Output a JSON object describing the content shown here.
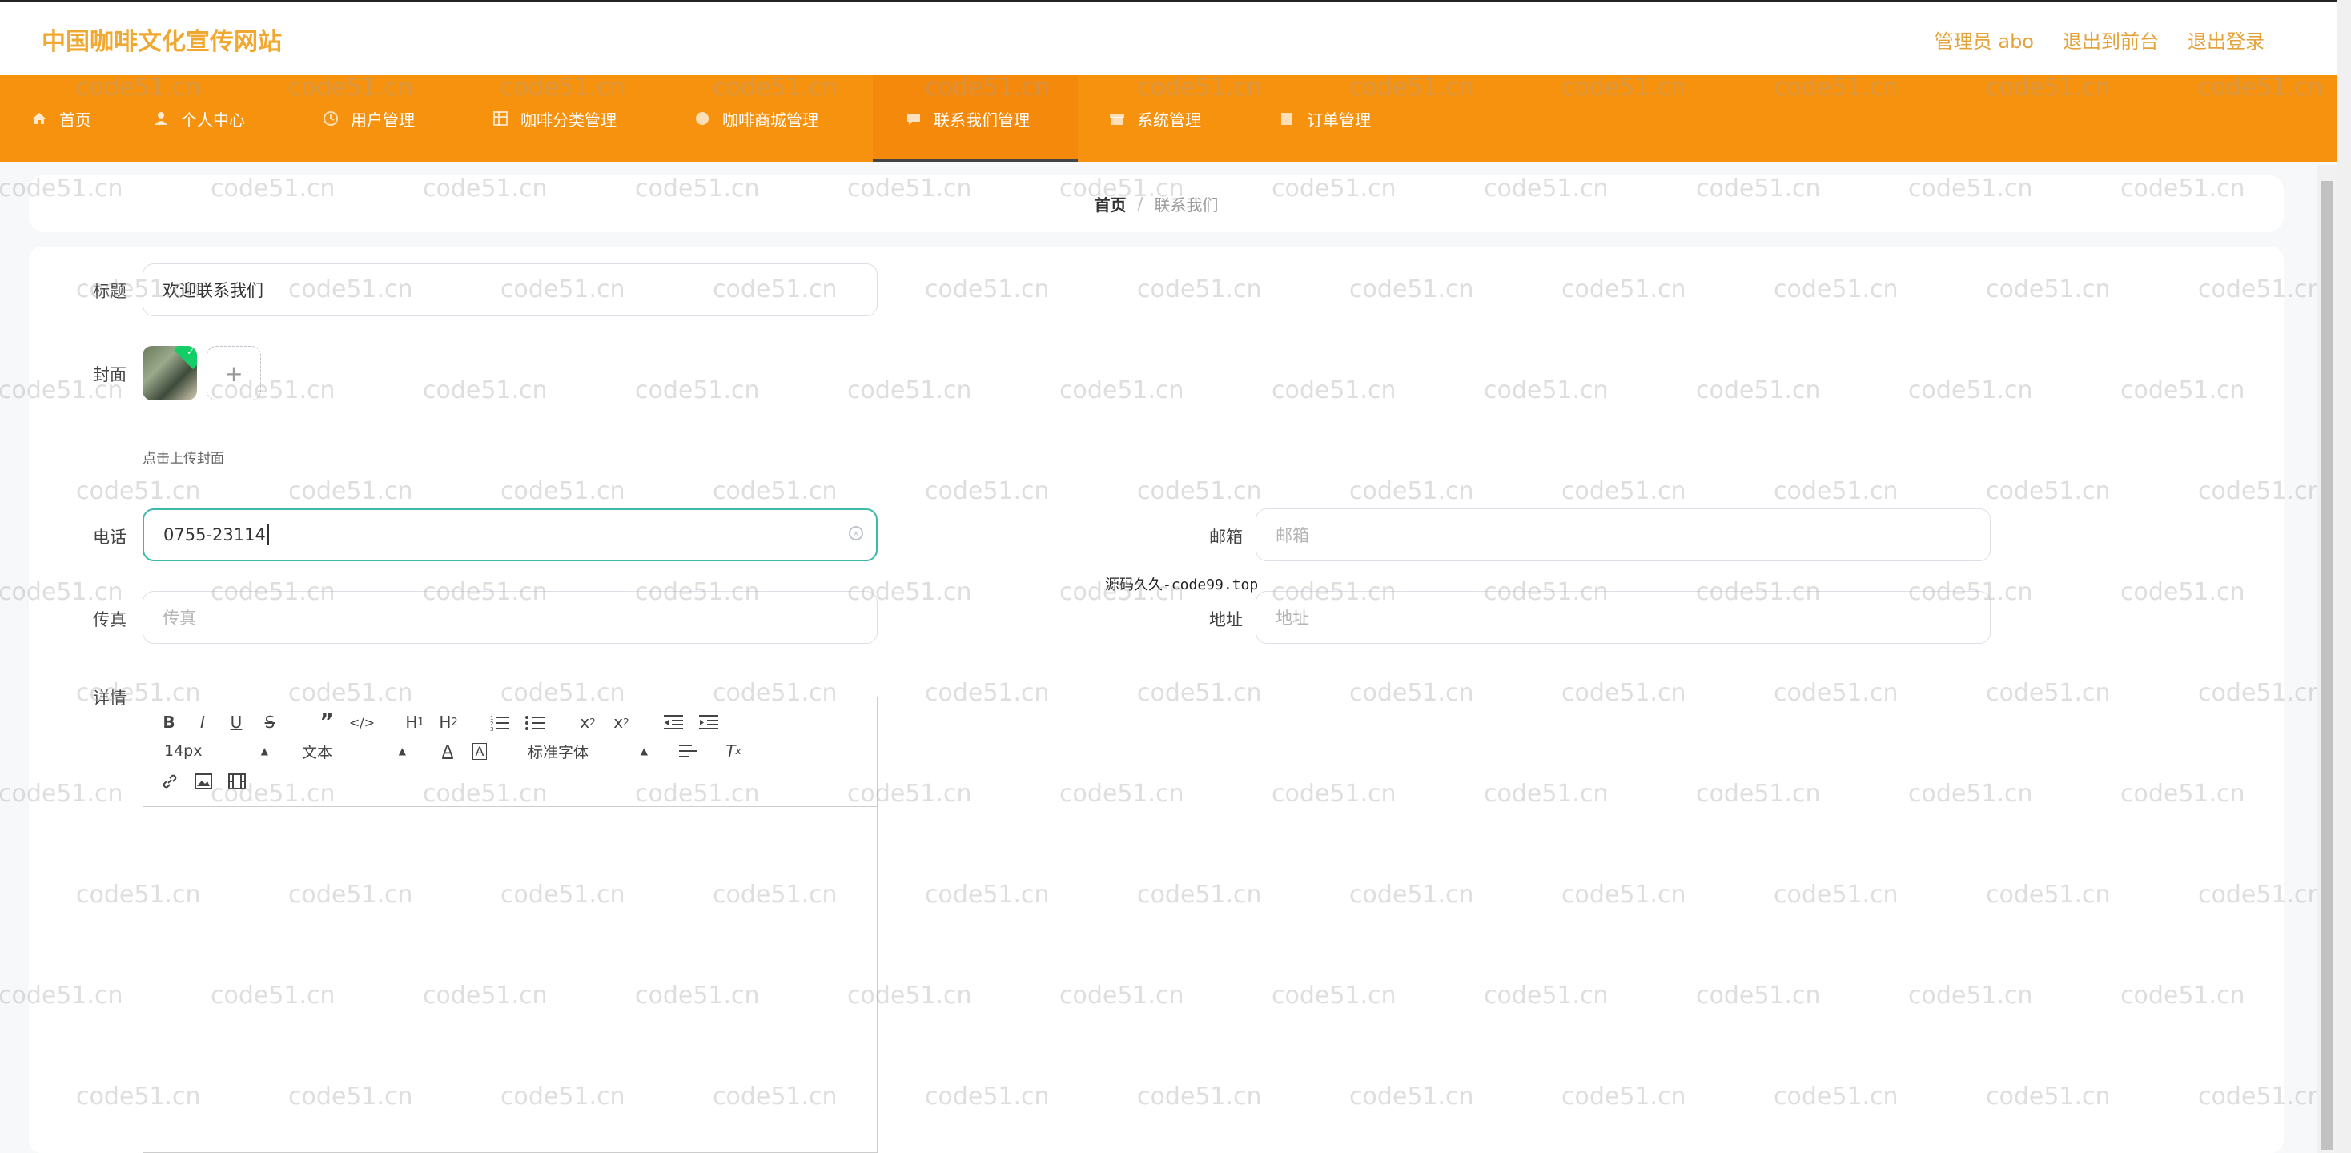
{
  "header": {
    "site_title": "中国咖啡文化宣传网站",
    "admin_label": "管理员 abo",
    "front_link": "退出到前台",
    "logout_link": "退出登录"
  },
  "nav": {
    "items": [
      {
        "label": "首页",
        "icon": "home-icon"
      },
      {
        "label": "个人中心",
        "icon": "user-icon"
      },
      {
        "label": "用户管理",
        "icon": "clock-icon"
      },
      {
        "label": "咖啡分类管理",
        "icon": "grid-icon"
      },
      {
        "label": "咖啡商城管理",
        "icon": "circle-icon"
      },
      {
        "label": "联系我们管理",
        "icon": "chat-icon"
      },
      {
        "label": "系统管理",
        "icon": "gift-icon"
      },
      {
        "label": "订单管理",
        "icon": "box-icon"
      }
    ],
    "active_index": 5
  },
  "breadcrumb": {
    "home": "首页",
    "separator": "/",
    "current": "联系我们"
  },
  "form": {
    "title_label": "标题",
    "title_value": "欢迎联系我们",
    "cover_label": "封面",
    "cover_hint": "点击上传封面",
    "phone_label": "电话",
    "phone_value": "0755-23114",
    "email_label": "邮箱",
    "email_placeholder": "邮箱",
    "fax_label": "传真",
    "fax_placeholder": "传真",
    "address_label": "地址",
    "address_placeholder": "地址",
    "detail_label": "详情"
  },
  "editor": {
    "font_size": "14px",
    "block_format": "文本",
    "font_family": "标准字体"
  },
  "watermark": {
    "text": "code51.cn",
    "center_text": "源码久久-code99.top"
  }
}
